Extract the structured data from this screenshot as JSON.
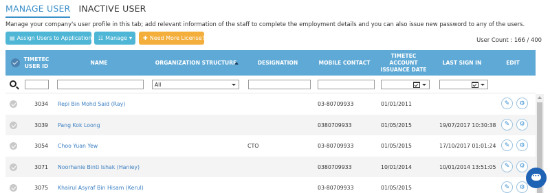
{
  "tabs": [
    {
      "label": "MANAGE USER",
      "active": true
    },
    {
      "label": "INACTIVE USER",
      "active": false
    }
  ],
  "description": "Manage your company's user profile in this tab; add relevant information of the staff to complete the employment details and you can also issue new password to any of the users.",
  "toolbar": {
    "assign_label": "Assign Users to Applications",
    "manage_label": "Manage",
    "license_label": "Need More License?"
  },
  "user_count": "User Count : 166 / 400",
  "columns": {
    "user_id": "TIMETEC USER ID",
    "name": "NAME",
    "org": "ORGANIZATION STRUCTURE",
    "designation": "DESIGNATION",
    "mobile": "MOBILE CONTACT",
    "issuance": "TIMETEC ACCOUNT ISSUANCE DATE",
    "last_sign_in": "LAST SIGN IN",
    "edit": "EDIT"
  },
  "filters": {
    "org_selected": "All"
  },
  "rows": [
    {
      "id": "3034",
      "name": "Repi Bin Mohd Said (Ray)",
      "designation": "",
      "mobile": "03-80709933",
      "issuance": "01/01/2011",
      "last_sign_in": ""
    },
    {
      "id": "3039",
      "name": "Pang Kok Loong",
      "designation": "",
      "mobile": "0380709933",
      "issuance": "01/05/2015",
      "last_sign_in": "19/07/2017 10:30:38"
    },
    {
      "id": "3054",
      "name": "Choo Yuan Yew",
      "designation": "CTO",
      "mobile": "03-80709933",
      "issuance": "01/05/2015",
      "last_sign_in": "17/10/2017 01:01:24"
    },
    {
      "id": "3071",
      "name": "Noorhanie Binti Ishak (Haniey)",
      "designation": "",
      "mobile": "0380709933",
      "issuance": "10/01/2014",
      "last_sign_in": "10/01/2014 13:51:05"
    },
    {
      "id": "3075",
      "name": "Khairul Asyraf Bin Hisam (Kerul)",
      "designation": "",
      "mobile": "03-80709933",
      "issuance": "01/05/2015",
      "last_sign_in": ""
    }
  ],
  "colors": {
    "accent": "#3b8fc9",
    "header_bg": "#5fa9d6",
    "button_blue": "#4fb6d6",
    "button_orange": "#f3ae3b",
    "link": "#3a7ec1",
    "chat": "#1f63b5"
  },
  "icons": {
    "assign": "list-icon",
    "manage": "sitemap-icon",
    "license": "plus-icon",
    "edit": "pencil-icon",
    "settings": "gear-icon",
    "search": "search-icon",
    "calendar": "calendar-icon",
    "chat": "chat-icon"
  }
}
